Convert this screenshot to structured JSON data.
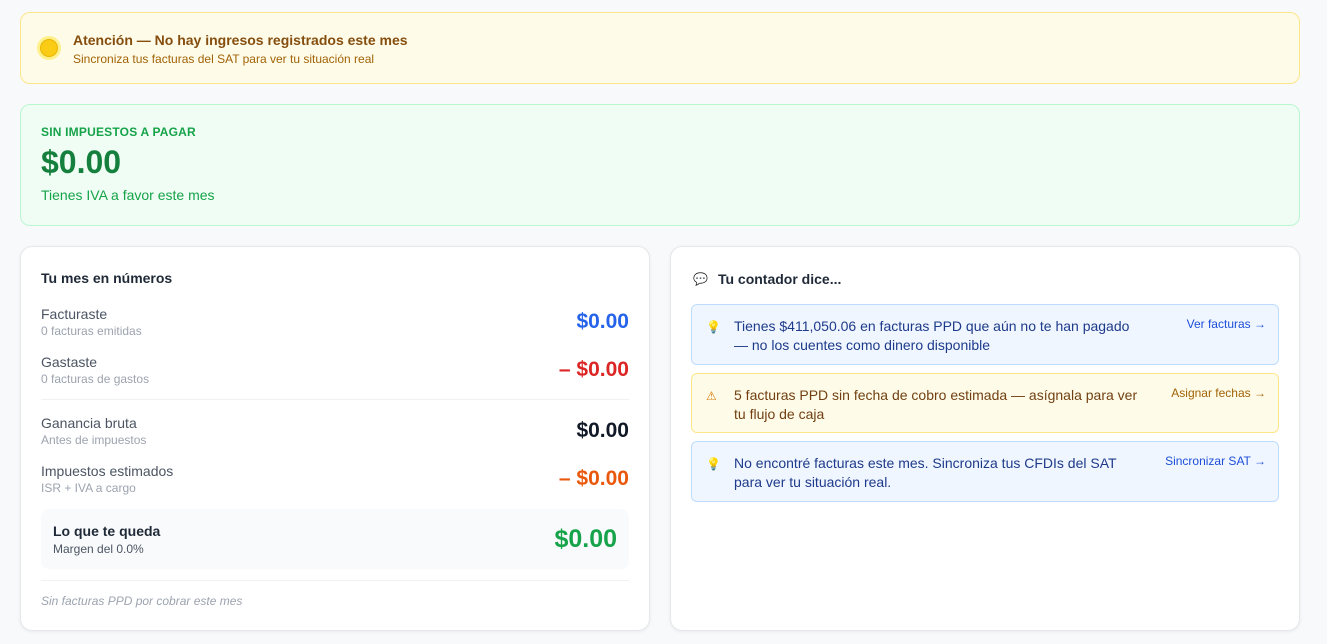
{
  "alert": {
    "icon": "warning-dot-icon",
    "title": "Atención — No hay ingresos registrados este mes",
    "subtitle": "Sincroniza tus facturas del SAT para ver tu situación real"
  },
  "tax": {
    "label": "SIN IMPUESTOS A PAGAR",
    "amount": "$0.00",
    "note": "Tienes IVA a favor este mes"
  },
  "month": {
    "title": "Tu mes en números",
    "rows": [
      {
        "label": "Facturaste",
        "sub": "0 facturas emitidas",
        "value": "$0.00",
        "color": "#2563eb"
      },
      {
        "label": "Gastaste",
        "sub": "0 facturas de gastos",
        "value": "– $0.00",
        "color": "#dc2626"
      },
      {
        "label": "Ganancia bruta",
        "sub": "Antes de impuestos",
        "value": "$0.00",
        "color": "#111827"
      },
      {
        "label": "Impuestos estimados",
        "sub": "ISR + IVA a cargo",
        "value": "– $0.00",
        "color": "#ea580c"
      }
    ],
    "keep": {
      "label": "Lo que te queda",
      "sub": "Margen del 0.0%",
      "value": "$0.00"
    },
    "footnote": "Sin facturas PPD por cobrar este mes"
  },
  "advisor": {
    "title": "Tu contador dice...",
    "icon": "speech-bubble-icon",
    "tips": [
      {
        "icon": "lightbulb-icon",
        "glyph": "💡",
        "text": "Tienes $411,050.06 en facturas PPD que aún no te han pagado — no los cuentes como dinero disponible",
        "action": "Ver facturas →"
      },
      {
        "icon": "warning-triangle-icon",
        "glyph": "⚠",
        "text": "5 facturas PPD sin fecha de cobro estimada — asígnala para ver tu flujo de caja",
        "action": "Asignar fechas →"
      },
      {
        "icon": "lightbulb-icon",
        "glyph": "💡",
        "text": "No encontré facturas este mes. Sincroniza tus CFDIs del SAT para ver tu situación real.",
        "action": "Sincronizar SAT →"
      }
    ]
  }
}
